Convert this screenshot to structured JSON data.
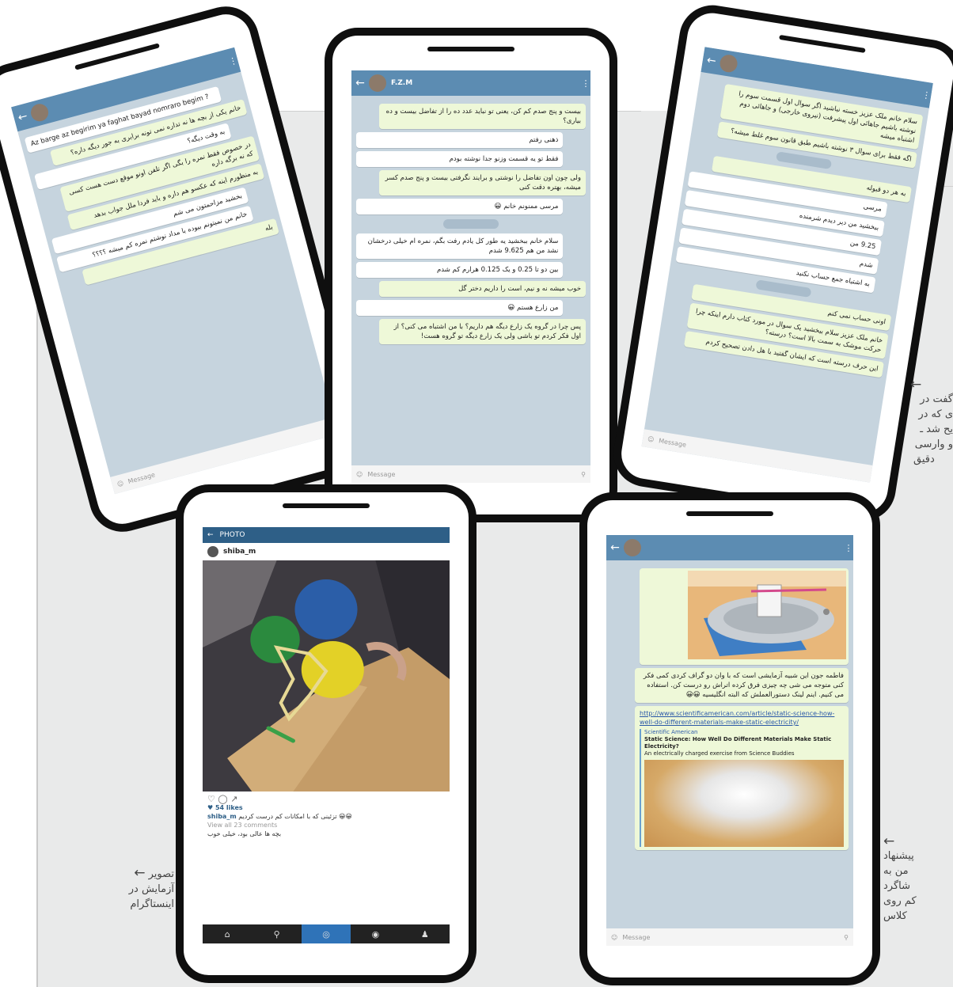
{
  "captions": {
    "right_top": [
      "گفت در",
      "ی که در",
      "یح شد ـ",
      "و وارسی",
      "دقیق"
    ],
    "right_bottom": [
      "پیشنهاد",
      "من به",
      "شاگرد",
      "کم روی",
      "کلاس"
    ],
    "left_bottom": [
      "تصویر",
      "آزمایش در",
      "اینستاگرام"
    ],
    "arrow": "←"
  },
  "phone1": {
    "name": "",
    "status": "",
    "messages": [
      {
        "dir": "in",
        "ltr": true,
        "text": "Az barge az begirim ya faghat bayad nomraro begim ?"
      },
      {
        "dir": "out",
        "text": "خانم یکی از بچه ها نه تداره نمی تونه برابری به جور دیگه داره؟"
      },
      {
        "dir": "in",
        "text": "به وقت دیگه؟"
      },
      {
        "dir": "out",
        "text": "در خصوص فقط نمره را بگی اگر تلفن اونو موقع دست هست کسی که نه برگه داره"
      },
      {
        "dir": "out",
        "text": "به منظورم اینه که عکسو هم داره و باید فردا ملل جواب بدهد"
      },
      {
        "dir": "in",
        "text": "بخشید مزاحمتون می شم"
      },
      {
        "dir": "in",
        "text": "خانم من نمیتونم بیوده با مداد نوشتم نمره کم میشه ؟؟؟؟"
      },
      {
        "dir": "out",
        "text": "بله"
      }
    ],
    "input": "Message"
  },
  "phone2": {
    "name": "F.Z.M",
    "status": "",
    "messages": [
      {
        "dir": "out",
        "text": "بیست و پنج صدم کم کن، یعنی تو نباید عدد ده را از تفاضل بیست و ده بیاری؟"
      },
      {
        "dir": "in",
        "text": "ذهنی رفتم"
      },
      {
        "dir": "in",
        "text": "فقط تو یه قسمت وزنو جدا نوشته بودم"
      },
      {
        "dir": "out",
        "text": "ولی چون اون تفاضل را نوشتی و برایند نگرفتی بیست و پنج صدم کسر میشه، بهتره دقت کنی"
      },
      {
        "dir": "in",
        "text": "مرسی ممنونم خانم 😀"
      },
      {
        "dir": "in",
        "text": "سلام خانم ببخشید یه طور کل یادم رفت بگم، نمره ام خیلی درخشان نشد من هم 9.625 شدم"
      },
      {
        "dir": "in",
        "text": "بین دو تا 0.25 و یک 0.125 هرارم کم شدم"
      },
      {
        "dir": "out",
        "text": "خوب میشه نه و نیم، است را داریم دختر گل"
      },
      {
        "dir": "in",
        "text": "من زارع هستم 😀"
      },
      {
        "dir": "out",
        "text": "پس چرا در گروه یک زارع دیگه هم داریم؟ با من اشتباه می کنی؟ از اول فکر کردم تو باشی ولی یک زارع دیگه تو گروه هست!"
      }
    ],
    "input": "Message"
  },
  "phone3": {
    "name": "",
    "status": "",
    "messages": [
      {
        "dir": "out",
        "text": "سلام خانم ملک عزیز خسته نباشید اگر سوال اول قسمت سوم را نوشته باشیم جاهائی اول پیشرفت (نیروی خارجی) و جاهائی دوم اشتباه میشه"
      },
      {
        "dir": "out",
        "text": "اگه فقط برای سوال ۳ نوشته باشیم طبق قانون سوم غلط میشه؟"
      },
      {
        "dir": "out",
        "text": "به هر دو قبوله"
      },
      {
        "dir": "in",
        "text": "مرسی"
      },
      {
        "dir": "in",
        "text": "ببخشید من دیر دیدم شرمنده"
      },
      {
        "dir": "in",
        "text": "9.25 من"
      },
      {
        "dir": "in",
        "text": "شدم"
      },
      {
        "dir": "in",
        "text": "به اشتباه جمع حساب نکنید"
      },
      {
        "dir": "out",
        "text": "اونی حساب نمی کنم"
      },
      {
        "dir": "out",
        "text": "خانم ملک عزیز سلام ببخشید یک سوال در مورد کتاب دارم اینکه چرا حرکت موشک به سمت بالا است؟ درسته؟"
      },
      {
        "dir": "out",
        "text": "این حرف درسته است که ایشان گفتید با هل دادن تصحیح کردم"
      }
    ],
    "input": "Message"
  },
  "phone4": {
    "header": "PHOTO",
    "username": "shiba_m",
    "likes": "♥ 54 likes",
    "caption_user": "shiba_m",
    "caption_text": "تزئینی که با امکانات کم درست کردیم 😀😀",
    "comments": "View all 23 comments",
    "comment2": "بچه ها عالی بود، خیلی خوب",
    "nav": [
      "⌂",
      "⚲",
      "◎",
      "◉",
      "♟"
    ]
  },
  "phone5": {
    "name": "",
    "status": "",
    "message": "فاطمه جون این شبیه آزمایشی است که با وان دو گراف کردی کمی فکر کنی متوجه می شی چه چیزی فرق کرده اتراش رو درست کن. استفاده می کنیم. اینم لینک دستورالعملش که البته انگلیسیه 😀😀",
    "link": "http://www.scientificamerican.com/article/static-science-how-well-do-different-materials-make-static-electricity/",
    "preview_site": "Scientific American",
    "preview_title": "Static Science: How Well Do Different Materials Make Static Electricity?",
    "preview_desc": "An electrically charged exercise from Science Buddies",
    "input": "Message"
  }
}
